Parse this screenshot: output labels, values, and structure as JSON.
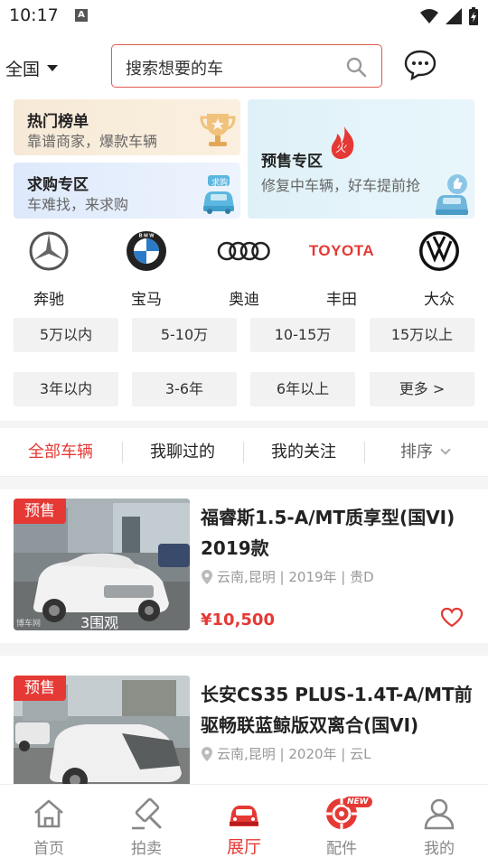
{
  "status_bar": {
    "time": "10:17",
    "notif_glyph": "A"
  },
  "header": {
    "region": "全国",
    "search_placeholder": "搜索想要的车"
  },
  "promos": {
    "hot": {
      "title": "热门榜单",
      "subtitle": "靠谱商家，爆款车辆"
    },
    "buy": {
      "title": "求购专区",
      "subtitle": "车难找，来求购",
      "tag": "求购"
    },
    "presale": {
      "title": "预售专区",
      "subtitle": "修复中车辆，好车提前抢",
      "fire_glyph": "火"
    }
  },
  "brands": [
    {
      "label": "奔驰",
      "icon": "mercedes-logo"
    },
    {
      "label": "宝马",
      "icon": "bmw-logo",
      "logo_text": "B M W"
    },
    {
      "label": "奥迪",
      "icon": "audi-logo"
    },
    {
      "label": "丰田",
      "icon": "toyota-logo",
      "logo_text": "TOYOTA"
    },
    {
      "label": "大众",
      "icon": "volkswagen-logo"
    }
  ],
  "price_filters": [
    "5万以内",
    "5-10万",
    "10-15万",
    "15万以上"
  ],
  "age_filters": [
    "3年以内",
    "3-6年",
    "6年以上",
    "更多 >"
  ],
  "tabs": {
    "all": "全部车辆",
    "chatted": "我聊过的",
    "following": "我的关注",
    "sort": "排序"
  },
  "listings": [
    {
      "badge": "预售",
      "title": "福睿斯1.5-A/MT质享型(国VI) 2019款",
      "meta": "云南,昆明 | 2019年 | 贵D",
      "price": "¥10,500",
      "views": "3围观",
      "watermark": "博车网"
    },
    {
      "badge": "预售",
      "title": "长安CS35 PLUS-1.4T-A/MT前驱畅联蓝鲸版双离合(国VI)",
      "meta": "云南,昆明 | 2020年 | 云L"
    }
  ],
  "bottom_nav": [
    {
      "label": "首页",
      "icon": "home-icon"
    },
    {
      "label": "拍卖",
      "icon": "auction-hammer-icon"
    },
    {
      "label": "展厅",
      "icon": "showroom-car-icon",
      "active": true
    },
    {
      "label": "配件",
      "icon": "parts-icon",
      "badge": "NEW"
    },
    {
      "label": "我的",
      "icon": "profile-icon"
    }
  ],
  "colors": {
    "accent": "#e53935",
    "search_border": "#e05a4f",
    "chip_bg": "#f2f2f2"
  }
}
